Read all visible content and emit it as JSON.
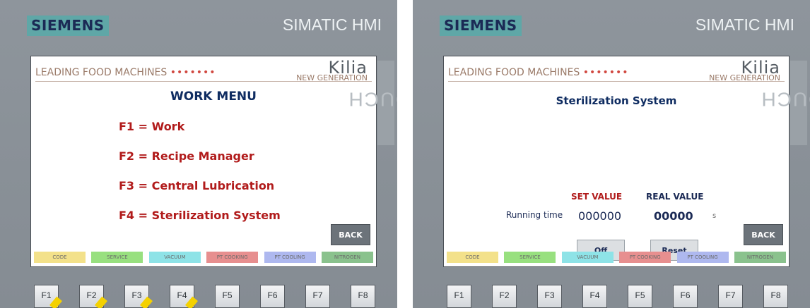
{
  "common": {
    "brand": "SIEMENS",
    "product": "SIMATIC HMI",
    "touch": "TOUCH",
    "leading": "LEADING FOOD MACHINES",
    "dots": "•••••••",
    "kilia": "Kilia",
    "tagline": "NEW GENERATION",
    "back": "BACK",
    "status": [
      {
        "label": "CODE",
        "color": "#f3e18a"
      },
      {
        "label": "SERVICE",
        "color": "#98e07f"
      },
      {
        "label": "VACUUM",
        "color": "#8ee3e7"
      },
      {
        "label": "PT COOKING",
        "color": "#e78f8f"
      },
      {
        "label": "PT COOLING",
        "color": "#aeb8ef"
      },
      {
        "label": "NITROGEN",
        "color": "#8ac28d"
      }
    ],
    "fkeys": [
      "F1",
      "F2",
      "F3",
      "F4",
      "F5",
      "F6",
      "F7",
      "F8"
    ]
  },
  "work_menu": {
    "title": "WORK MENU",
    "items": [
      "F1 = Work",
      "F2 = Recipe Manager",
      "F3 = Central Lubrication",
      "F4 = Sterilization System"
    ]
  },
  "sterilization": {
    "title": "Sterilization System",
    "set_value_label": "SET VALUE",
    "real_value_label": "REAL VALUE",
    "running_label": "Running time",
    "set_value": "000000",
    "real_value": "00000",
    "unit": "s",
    "off": "Off",
    "reset": "Reset"
  }
}
